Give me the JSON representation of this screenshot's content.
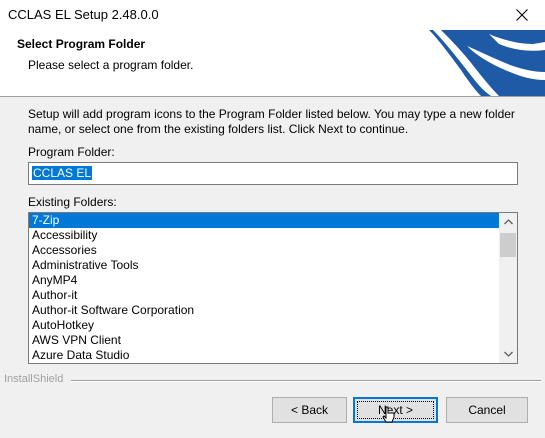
{
  "window": {
    "title": "CCLAS EL Setup 2.48.0.0"
  },
  "header": {
    "title": "Select Program Folder",
    "subtitle": "Please select a program folder."
  },
  "body": {
    "description": "Setup will add program icons to the Program Folder listed below.  You may type a new folder name, or select one from the existing folders list.  Click Next to continue.",
    "program_folder_label": "Program Folder:",
    "program_folder_value": "CCLAS EL",
    "existing_folders_label": "Existing Folders:",
    "existing_folders": [
      "7-Zip",
      "Accessibility",
      "Accessories",
      "Administrative Tools",
      "AnyMP4",
      "Author-it",
      "Author-it Software Corporation",
      "AutoHotkey",
      "AWS VPN Client",
      "Azure Data Studio"
    ],
    "selected_index": 0
  },
  "footer": {
    "brand": "InstallShield",
    "back_label": "< Back",
    "next_label": "Next >",
    "cancel_label": "Cancel"
  },
  "colors": {
    "selection": "#0078d7",
    "logo_blue": "#1f5aa6",
    "window_bg": "#f0f0f0"
  },
  "icons": [
    "close-icon",
    "installer-logo",
    "scroll-up-arrow-icon",
    "scroll-down-arrow-icon",
    "mouse-cursor-icon"
  ]
}
